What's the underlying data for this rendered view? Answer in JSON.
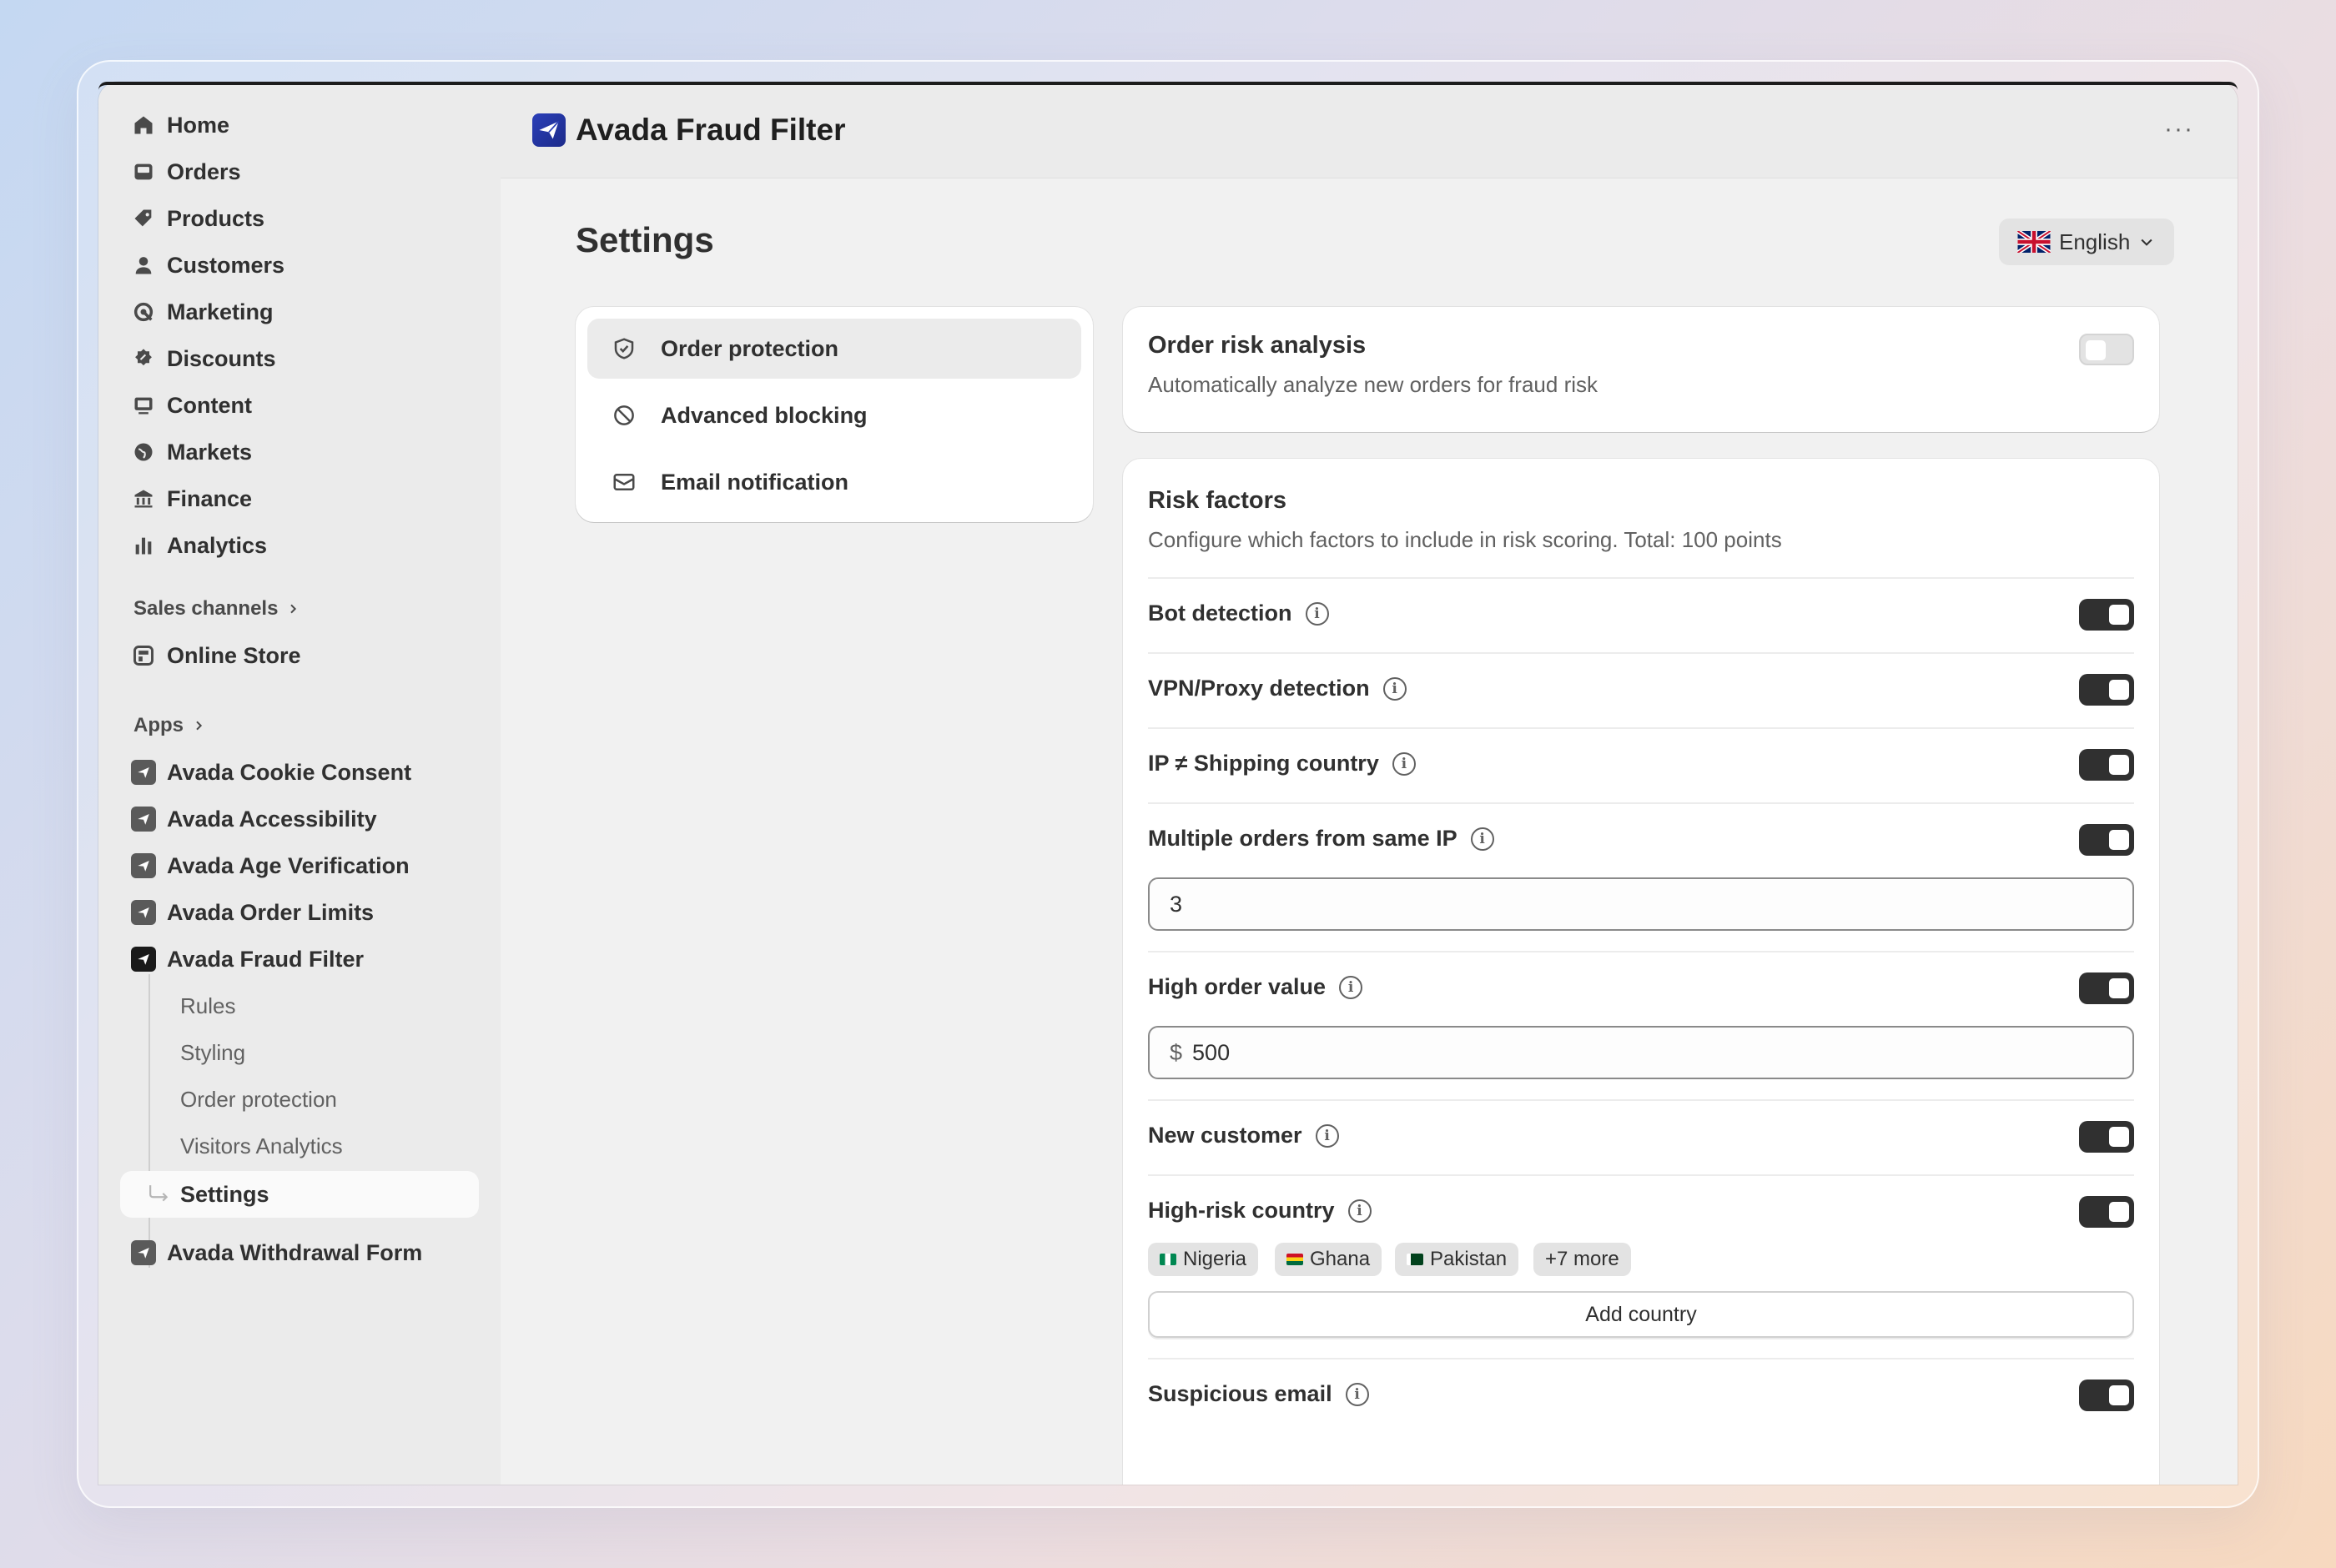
{
  "sidebar": {
    "nav": [
      {
        "label": "Home",
        "icon": "home-icon"
      },
      {
        "label": "Orders",
        "icon": "inbox-icon"
      },
      {
        "label": "Products",
        "icon": "tag-icon"
      },
      {
        "label": "Customers",
        "icon": "person-icon"
      },
      {
        "label": "Marketing",
        "icon": "target-icon"
      },
      {
        "label": "Discounts",
        "icon": "discount-icon"
      },
      {
        "label": "Content",
        "icon": "image-icon"
      },
      {
        "label": "Markets",
        "icon": "globe-icon"
      },
      {
        "label": "Finance",
        "icon": "bank-icon"
      },
      {
        "label": "Analytics",
        "icon": "bar-chart-icon"
      }
    ],
    "sales_channels_label": "Sales channels",
    "online_store_label": "Online Store",
    "apps_label": "Apps",
    "apps": [
      {
        "label": "Avada Cookie Consent"
      },
      {
        "label": "Avada Accessibility"
      },
      {
        "label": "Avada Age Verification"
      },
      {
        "label": "Avada Order Limits"
      },
      {
        "label": "Avada Fraud Filter"
      }
    ],
    "sub_items": [
      {
        "label": "Rules"
      },
      {
        "label": "Styling"
      },
      {
        "label": "Order protection"
      },
      {
        "label": "Visitors Analytics"
      }
    ],
    "settings_label": "Settings",
    "withdrawal_label": "Avada Withdrawal Form"
  },
  "header": {
    "app_title": "Avada Fraud Filter",
    "more_label": "···"
  },
  "page": {
    "title": "Settings",
    "language": "English"
  },
  "settings_menu": [
    {
      "label": "Order protection",
      "icon": "shield-check-icon",
      "active": true
    },
    {
      "label": "Advanced blocking",
      "icon": "block-icon",
      "active": false
    },
    {
      "label": "Email notification",
      "icon": "mail-icon",
      "active": false
    }
  ],
  "order_risk": {
    "title": "Order risk analysis",
    "subtitle": "Automatically analyze new orders for fraud risk",
    "enabled": false
  },
  "risk_factors": {
    "title": "Risk factors",
    "subtitle": "Configure which factors to include in risk scoring. Total: 100 points",
    "factors": [
      {
        "label": "Bot detection",
        "enabled": true
      },
      {
        "label": "VPN/Proxy detection",
        "enabled": true
      },
      {
        "label": "IP ≠ Shipping country",
        "enabled": true
      },
      {
        "label": "Multiple orders from same IP",
        "enabled": true
      },
      {
        "label": "High order value",
        "enabled": true
      },
      {
        "label": "New customer",
        "enabled": true
      },
      {
        "label": "High-risk country",
        "enabled": true
      },
      {
        "label": "Suspicious email",
        "enabled": true
      }
    ],
    "same_ip_value": "3",
    "currency_symbol": "$",
    "order_value": "500",
    "countries": [
      "Nigeria",
      "Ghana",
      "Pakistan"
    ],
    "more_countries": "+7 more",
    "add_country_label": "Add country"
  },
  "colors": {
    "toggle_on": "#303030",
    "toggle_off": "#e3e3e3",
    "brand": "#2a3fb8"
  }
}
